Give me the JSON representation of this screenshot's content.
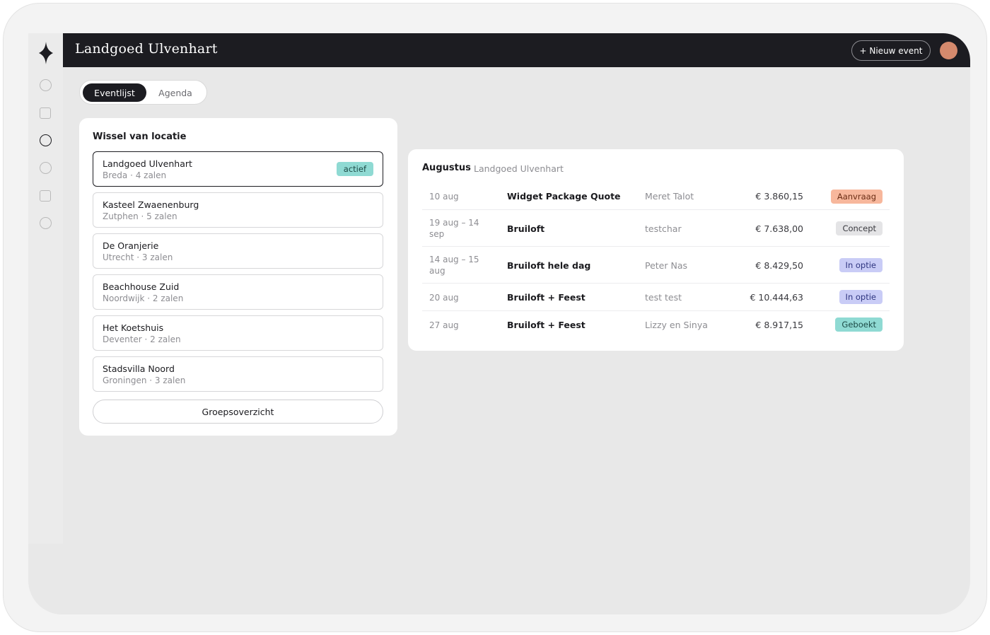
{
  "colors": {
    "topbar": "#1c1c21",
    "accent_active": "#8fdad3",
    "status_aanvraag": "#f7b79c",
    "status_concept": "#e4e4e6",
    "status_in_optie": "#c9ccf6",
    "status_geboekt": "#8fdad3",
    "avatar": "#d58a6d"
  },
  "rail": {
    "icons": [
      "circle-icon",
      "square-icon",
      "circle-icon-active",
      "circle-icon",
      "square-icon",
      "circle-icon"
    ]
  },
  "header": {
    "title": "Landgoed Ulvenhart",
    "new_event_label": "+ Nieuw event"
  },
  "tabs": [
    {
      "label": "Eventlijst",
      "active": true
    },
    {
      "label": "Agenda",
      "active": false
    }
  ],
  "locations": {
    "heading": "Wissel van locatie",
    "active_badge": "actief",
    "items": [
      {
        "name": "Landgoed Ulvenhart",
        "sub": "Breda · 4 zalen",
        "active": true
      },
      {
        "name": "Kasteel Zwaenenburg",
        "sub": "Zutphen · 5 zalen",
        "active": false
      },
      {
        "name": "De Oranjerie",
        "sub": "Utrecht · 3 zalen",
        "active": false
      },
      {
        "name": "Beachhouse Zuid",
        "sub": "Noordwijk · 2 zalen",
        "active": false
      },
      {
        "name": "Het Koetshuis",
        "sub": "Deventer · 2 zalen",
        "active": false
      },
      {
        "name": "Stadsvilla Noord",
        "sub": "Groningen · 3 zalen",
        "active": false
      }
    ],
    "group_button": "Groepsoverzicht"
  },
  "events": {
    "month": "Augustus",
    "location": "Landgoed Ulvenhart",
    "rows": [
      {
        "date": "10 aug",
        "title": "Widget Package Quote",
        "client": "Meret Talot",
        "amount": "€ 3.860,15",
        "status": "Aanvraag",
        "status_key": "aanvraag"
      },
      {
        "date": "19 aug – 14 sep",
        "title": "Bruiloft",
        "client": "testchar",
        "amount": "€ 7.638,00",
        "status": "Concept",
        "status_key": "concept"
      },
      {
        "date": "14 aug – 15 aug",
        "title": "Bruiloft hele dag",
        "client": "Peter Nas",
        "amount": "€ 8.429,50",
        "status": "In optie",
        "status_key": "in_optie"
      },
      {
        "date": "20 aug",
        "title": "Bruiloft + Feest",
        "client": "test test",
        "amount": "€ 10.444,63",
        "status": "In optie",
        "status_key": "in_optie"
      },
      {
        "date": "27 aug",
        "title": "Bruiloft + Feest",
        "client": "Lizzy en Sinya",
        "amount": "€ 8.917,15",
        "status": "Geboekt",
        "status_key": "geboekt"
      }
    ]
  }
}
